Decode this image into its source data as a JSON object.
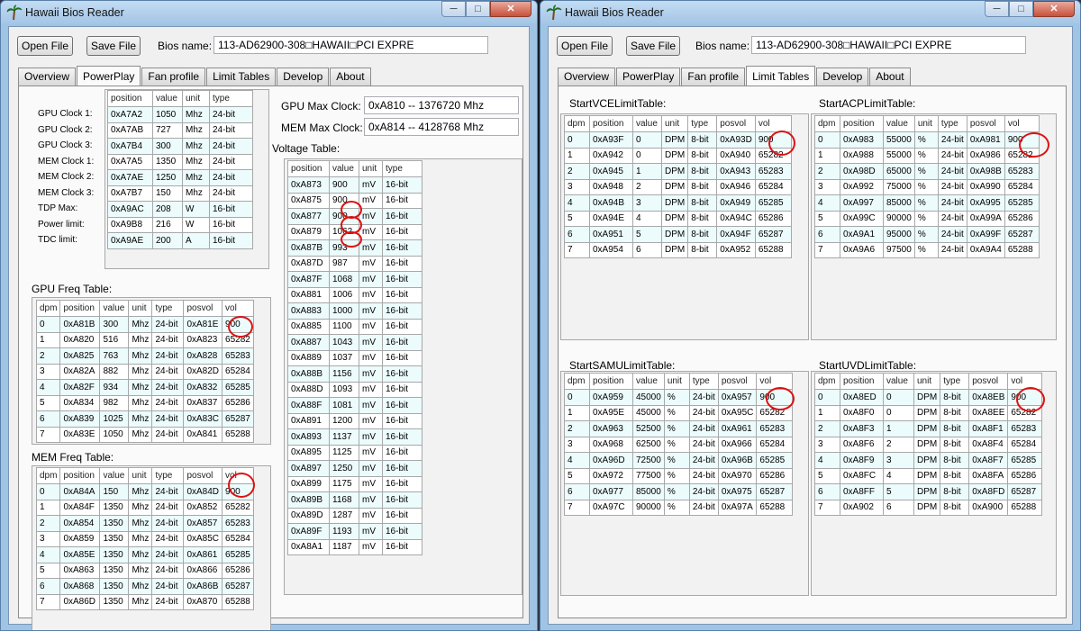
{
  "left": {
    "title": "Hawaii Bios Reader",
    "open_file": "Open File",
    "save_file": "Save File",
    "bios_name_label": "Bios name:",
    "bios_name_value": "113-AD62900-308□HAWAII□PCI EXPRE",
    "tabs": [
      "Overview",
      "PowerPlay",
      "Fan profile",
      "Limit Tables",
      "Develop",
      "About"
    ],
    "active_tab": "PowerPlay",
    "clock_headers": [
      "position",
      "value",
      "unit",
      "type"
    ],
    "clock_labels": [
      "GPU Clock 1:",
      "GPU Clock 2:",
      "GPU Clock 3:",
      "MEM Clock 1:",
      "MEM Clock 2:",
      "MEM Clock 3:",
      "TDP Max:",
      "Power limit:",
      "TDC limit:"
    ],
    "clock_rows": [
      [
        "0xA7A2",
        "1050",
        "Mhz",
        "24-bit"
      ],
      [
        "0xA7AB",
        "727",
        "Mhz",
        "24-bit"
      ],
      [
        "0xA7B4",
        "300",
        "Mhz",
        "24-bit"
      ],
      [
        "0xA7A5",
        "1350",
        "Mhz",
        "24-bit"
      ],
      [
        "0xA7AE",
        "1250",
        "Mhz",
        "24-bit"
      ],
      [
        "0xA7B7",
        "150",
        "Mhz",
        "24-bit"
      ],
      [
        "0xA9AC",
        "208",
        "W",
        "16-bit"
      ],
      [
        "0xA9B8",
        "216",
        "W",
        "16-bit"
      ],
      [
        "0xA9AE",
        "200",
        "A",
        "16-bit"
      ]
    ],
    "gpu_max_label": "GPU Max Clock:",
    "gpu_max_value": "0xA810 -- 1376720 Mhz",
    "mem_max_label": "MEM Max Clock:",
    "mem_max_value": "0xA814 -- 4128768 Mhz",
    "voltage_title": "Voltage Table:",
    "voltage_headers": [
      "position",
      "value",
      "unit",
      "type"
    ],
    "voltage_rows": [
      [
        "0xA873",
        "900",
        "mV",
        "16-bit"
      ],
      [
        "0xA875",
        "900",
        "mV",
        "16-bit"
      ],
      [
        "0xA877",
        "900",
        "mV",
        "16-bit"
      ],
      [
        "0xA879",
        "1062",
        "mV",
        "16-bit"
      ],
      [
        "0xA87B",
        "993",
        "mV",
        "16-bit"
      ],
      [
        "0xA87D",
        "987",
        "mV",
        "16-bit"
      ],
      [
        "0xA87F",
        "1068",
        "mV",
        "16-bit"
      ],
      [
        "0xA881",
        "1006",
        "mV",
        "16-bit"
      ],
      [
        "0xA883",
        "1000",
        "mV",
        "16-bit"
      ],
      [
        "0xA885",
        "1100",
        "mV",
        "16-bit"
      ],
      [
        "0xA887",
        "1043",
        "mV",
        "16-bit"
      ],
      [
        "0xA889",
        "1037",
        "mV",
        "16-bit"
      ],
      [
        "0xA88B",
        "1156",
        "mV",
        "16-bit"
      ],
      [
        "0xA88D",
        "1093",
        "mV",
        "16-bit"
      ],
      [
        "0xA88F",
        "1081",
        "mV",
        "16-bit"
      ],
      [
        "0xA891",
        "1200",
        "mV",
        "16-bit"
      ],
      [
        "0xA893",
        "1137",
        "mV",
        "16-bit"
      ],
      [
        "0xA895",
        "1125",
        "mV",
        "16-bit"
      ],
      [
        "0xA897",
        "1250",
        "mV",
        "16-bit"
      ],
      [
        "0xA899",
        "1175",
        "mV",
        "16-bit"
      ],
      [
        "0xA89B",
        "1168",
        "mV",
        "16-bit"
      ],
      [
        "0xA89D",
        "1287",
        "mV",
        "16-bit"
      ],
      [
        "0xA89F",
        "1193",
        "mV",
        "16-bit"
      ],
      [
        "0xA8A1",
        "1187",
        "mV",
        "16-bit"
      ]
    ],
    "gpu_freq_title": "GPU Freq Table:",
    "freq_headers": [
      "dpm",
      "position",
      "value",
      "unit",
      "type",
      "posvol",
      "vol"
    ],
    "gpu_freq_rows": [
      [
        "0",
        "0xA81B",
        "300",
        "Mhz",
        "24-bit",
        "0xA81E",
        "900"
      ],
      [
        "1",
        "0xA820",
        "516",
        "Mhz",
        "24-bit",
        "0xA823",
        "65282"
      ],
      [
        "2",
        "0xA825",
        "763",
        "Mhz",
        "24-bit",
        "0xA828",
        "65283"
      ],
      [
        "3",
        "0xA82A",
        "882",
        "Mhz",
        "24-bit",
        "0xA82D",
        "65284"
      ],
      [
        "4",
        "0xA82F",
        "934",
        "Mhz",
        "24-bit",
        "0xA832",
        "65285"
      ],
      [
        "5",
        "0xA834",
        "982",
        "Mhz",
        "24-bit",
        "0xA837",
        "65286"
      ],
      [
        "6",
        "0xA839",
        "1025",
        "Mhz",
        "24-bit",
        "0xA83C",
        "65287"
      ],
      [
        "7",
        "0xA83E",
        "1050",
        "Mhz",
        "24-bit",
        "0xA841",
        "65288"
      ]
    ],
    "mem_freq_title": "MEM Freq Table:",
    "mem_freq_rows": [
      [
        "0",
        "0xA84A",
        "150",
        "Mhz",
        "24-bit",
        "0xA84D",
        "900"
      ],
      [
        "1",
        "0xA84F",
        "1350",
        "Mhz",
        "24-bit",
        "0xA852",
        "65282"
      ],
      [
        "2",
        "0xA854",
        "1350",
        "Mhz",
        "24-bit",
        "0xA857",
        "65283"
      ],
      [
        "3",
        "0xA859",
        "1350",
        "Mhz",
        "24-bit",
        "0xA85C",
        "65284"
      ],
      [
        "4",
        "0xA85E",
        "1350",
        "Mhz",
        "24-bit",
        "0xA861",
        "65285"
      ],
      [
        "5",
        "0xA863",
        "1350",
        "Mhz",
        "24-bit",
        "0xA866",
        "65286"
      ],
      [
        "6",
        "0xA868",
        "1350",
        "Mhz",
        "24-bit",
        "0xA86B",
        "65287"
      ],
      [
        "7",
        "0xA86D",
        "1350",
        "Mhz",
        "24-bit",
        "0xA870",
        "65288"
      ]
    ]
  },
  "right": {
    "title": "Hawaii Bios Reader",
    "open_file": "Open File",
    "save_file": "Save File",
    "bios_name_label": "Bios name:",
    "bios_name_value": "113-AD62900-308□HAWAII□PCI EXPRE",
    "tabs": [
      "Overview",
      "PowerPlay",
      "Fan profile",
      "Limit Tables",
      "Develop",
      "About"
    ],
    "active_tab": "Limit Tables",
    "limit_headers": [
      "dpm",
      "position",
      "value",
      "unit",
      "type",
      "posvol",
      "vol"
    ],
    "vce_title": "StartVCELimitTable:",
    "vce_rows": [
      [
        "0",
        "0xA93F",
        "0",
        "DPM",
        "8-bit",
        "0xA93D",
        "900"
      ],
      [
        "1",
        "0xA942",
        "0",
        "DPM",
        "8-bit",
        "0xA940",
        "65282"
      ],
      [
        "2",
        "0xA945",
        "1",
        "DPM",
        "8-bit",
        "0xA943",
        "65283"
      ],
      [
        "3",
        "0xA948",
        "2",
        "DPM",
        "8-bit",
        "0xA946",
        "65284"
      ],
      [
        "4",
        "0xA94B",
        "3",
        "DPM",
        "8-bit",
        "0xA949",
        "65285"
      ],
      [
        "5",
        "0xA94E",
        "4",
        "DPM",
        "8-bit",
        "0xA94C",
        "65286"
      ],
      [
        "6",
        "0xA951",
        "5",
        "DPM",
        "8-bit",
        "0xA94F",
        "65287"
      ],
      [
        "7",
        "0xA954",
        "6",
        "DPM",
        "8-bit",
        "0xA952",
        "65288"
      ]
    ],
    "acp_title": "StartACPLimitTable:",
    "acp_rows": [
      [
        "0",
        "0xA983",
        "55000",
        "%",
        "24-bit",
        "0xA981",
        "900"
      ],
      [
        "1",
        "0xA988",
        "55000",
        "%",
        "24-bit",
        "0xA986",
        "65282"
      ],
      [
        "2",
        "0xA98D",
        "65000",
        "%",
        "24-bit",
        "0xA98B",
        "65283"
      ],
      [
        "3",
        "0xA992",
        "75000",
        "%",
        "24-bit",
        "0xA990",
        "65284"
      ],
      [
        "4",
        "0xA997",
        "85000",
        "%",
        "24-bit",
        "0xA995",
        "65285"
      ],
      [
        "5",
        "0xA99C",
        "90000",
        "%",
        "24-bit",
        "0xA99A",
        "65286"
      ],
      [
        "6",
        "0xA9A1",
        "95000",
        "%",
        "24-bit",
        "0xA99F",
        "65287"
      ],
      [
        "7",
        "0xA9A6",
        "97500",
        "%",
        "24-bit",
        "0xA9A4",
        "65288"
      ]
    ],
    "samu_title": "StartSAMULimitTable:",
    "samu_rows": [
      [
        "0",
        "0xA959",
        "45000",
        "%",
        "24-bit",
        "0xA957",
        "900"
      ],
      [
        "1",
        "0xA95E",
        "45000",
        "%",
        "24-bit",
        "0xA95C",
        "65282"
      ],
      [
        "2",
        "0xA963",
        "52500",
        "%",
        "24-bit",
        "0xA961",
        "65283"
      ],
      [
        "3",
        "0xA968",
        "62500",
        "%",
        "24-bit",
        "0xA966",
        "65284"
      ],
      [
        "4",
        "0xA96D",
        "72500",
        "%",
        "24-bit",
        "0xA96B",
        "65285"
      ],
      [
        "5",
        "0xA972",
        "77500",
        "%",
        "24-bit",
        "0xA970",
        "65286"
      ],
      [
        "6",
        "0xA977",
        "85000",
        "%",
        "24-bit",
        "0xA975",
        "65287"
      ],
      [
        "7",
        "0xA97C",
        "90000",
        "%",
        "24-bit",
        "0xA97A",
        "65288"
      ]
    ],
    "uvd_title": "StartUVDLimitTable:",
    "uvd_rows": [
      [
        "0",
        "0xA8ED",
        "0",
        "DPM",
        "8-bit",
        "0xA8EB",
        "900"
      ],
      [
        "1",
        "0xA8F0",
        "0",
        "DPM",
        "8-bit",
        "0xA8EE",
        "65282"
      ],
      [
        "2",
        "0xA8F3",
        "1",
        "DPM",
        "8-bit",
        "0xA8F1",
        "65283"
      ],
      [
        "3",
        "0xA8F6",
        "2",
        "DPM",
        "8-bit",
        "0xA8F4",
        "65284"
      ],
      [
        "4",
        "0xA8F9",
        "3",
        "DPM",
        "8-bit",
        "0xA8F7",
        "65285"
      ],
      [
        "5",
        "0xA8FC",
        "4",
        "DPM",
        "8-bit",
        "0xA8FA",
        "65286"
      ],
      [
        "6",
        "0xA8FF",
        "5",
        "DPM",
        "8-bit",
        "0xA8FD",
        "65287"
      ],
      [
        "7",
        "0xA902",
        "6",
        "DPM",
        "8-bit",
        "0xA900",
        "65288"
      ]
    ]
  },
  "colors": {
    "annotation_circle": "#d11111",
    "alt_row": "#ecfbfc",
    "title_bar": "#a3c5e6"
  },
  "icons": {
    "app": "palm-tree-icon",
    "minimize": "minimize-icon",
    "maximize": "maximize-icon",
    "close": "close-icon"
  }
}
